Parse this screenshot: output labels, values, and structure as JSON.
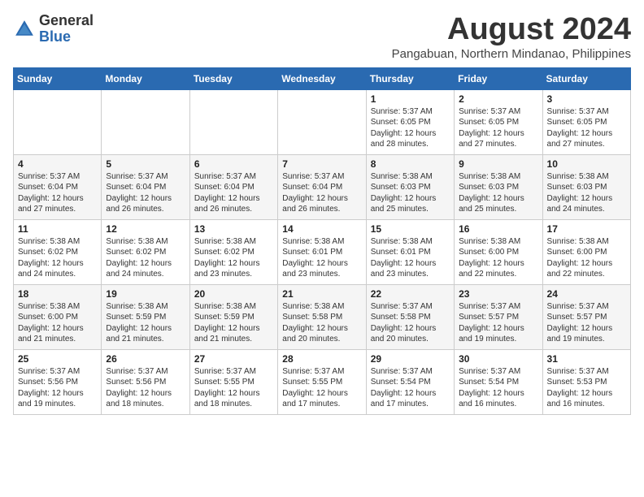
{
  "header": {
    "logo_general": "General",
    "logo_blue": "Blue",
    "month_title": "August 2024",
    "location": "Pangabuan, Northern Mindanao, Philippines"
  },
  "weekdays": [
    "Sunday",
    "Monday",
    "Tuesday",
    "Wednesday",
    "Thursday",
    "Friday",
    "Saturday"
  ],
  "weeks": [
    [
      {
        "day": "",
        "info": ""
      },
      {
        "day": "",
        "info": ""
      },
      {
        "day": "",
        "info": ""
      },
      {
        "day": "",
        "info": ""
      },
      {
        "day": "1",
        "info": "Sunrise: 5:37 AM\nSunset: 6:05 PM\nDaylight: 12 hours\nand 28 minutes."
      },
      {
        "day": "2",
        "info": "Sunrise: 5:37 AM\nSunset: 6:05 PM\nDaylight: 12 hours\nand 27 minutes."
      },
      {
        "day": "3",
        "info": "Sunrise: 5:37 AM\nSunset: 6:05 PM\nDaylight: 12 hours\nand 27 minutes."
      }
    ],
    [
      {
        "day": "4",
        "info": "Sunrise: 5:37 AM\nSunset: 6:04 PM\nDaylight: 12 hours\nand 27 minutes."
      },
      {
        "day": "5",
        "info": "Sunrise: 5:37 AM\nSunset: 6:04 PM\nDaylight: 12 hours\nand 26 minutes."
      },
      {
        "day": "6",
        "info": "Sunrise: 5:37 AM\nSunset: 6:04 PM\nDaylight: 12 hours\nand 26 minutes."
      },
      {
        "day": "7",
        "info": "Sunrise: 5:37 AM\nSunset: 6:04 PM\nDaylight: 12 hours\nand 26 minutes."
      },
      {
        "day": "8",
        "info": "Sunrise: 5:38 AM\nSunset: 6:03 PM\nDaylight: 12 hours\nand 25 minutes."
      },
      {
        "day": "9",
        "info": "Sunrise: 5:38 AM\nSunset: 6:03 PM\nDaylight: 12 hours\nand 25 minutes."
      },
      {
        "day": "10",
        "info": "Sunrise: 5:38 AM\nSunset: 6:03 PM\nDaylight: 12 hours\nand 24 minutes."
      }
    ],
    [
      {
        "day": "11",
        "info": "Sunrise: 5:38 AM\nSunset: 6:02 PM\nDaylight: 12 hours\nand 24 minutes."
      },
      {
        "day": "12",
        "info": "Sunrise: 5:38 AM\nSunset: 6:02 PM\nDaylight: 12 hours\nand 24 minutes."
      },
      {
        "day": "13",
        "info": "Sunrise: 5:38 AM\nSunset: 6:02 PM\nDaylight: 12 hours\nand 23 minutes."
      },
      {
        "day": "14",
        "info": "Sunrise: 5:38 AM\nSunset: 6:01 PM\nDaylight: 12 hours\nand 23 minutes."
      },
      {
        "day": "15",
        "info": "Sunrise: 5:38 AM\nSunset: 6:01 PM\nDaylight: 12 hours\nand 23 minutes."
      },
      {
        "day": "16",
        "info": "Sunrise: 5:38 AM\nSunset: 6:00 PM\nDaylight: 12 hours\nand 22 minutes."
      },
      {
        "day": "17",
        "info": "Sunrise: 5:38 AM\nSunset: 6:00 PM\nDaylight: 12 hours\nand 22 minutes."
      }
    ],
    [
      {
        "day": "18",
        "info": "Sunrise: 5:38 AM\nSunset: 6:00 PM\nDaylight: 12 hours\nand 21 minutes."
      },
      {
        "day": "19",
        "info": "Sunrise: 5:38 AM\nSunset: 5:59 PM\nDaylight: 12 hours\nand 21 minutes."
      },
      {
        "day": "20",
        "info": "Sunrise: 5:38 AM\nSunset: 5:59 PM\nDaylight: 12 hours\nand 21 minutes."
      },
      {
        "day": "21",
        "info": "Sunrise: 5:38 AM\nSunset: 5:58 PM\nDaylight: 12 hours\nand 20 minutes."
      },
      {
        "day": "22",
        "info": "Sunrise: 5:37 AM\nSunset: 5:58 PM\nDaylight: 12 hours\nand 20 minutes."
      },
      {
        "day": "23",
        "info": "Sunrise: 5:37 AM\nSunset: 5:57 PM\nDaylight: 12 hours\nand 19 minutes."
      },
      {
        "day": "24",
        "info": "Sunrise: 5:37 AM\nSunset: 5:57 PM\nDaylight: 12 hours\nand 19 minutes."
      }
    ],
    [
      {
        "day": "25",
        "info": "Sunrise: 5:37 AM\nSunset: 5:56 PM\nDaylight: 12 hours\nand 19 minutes."
      },
      {
        "day": "26",
        "info": "Sunrise: 5:37 AM\nSunset: 5:56 PM\nDaylight: 12 hours\nand 18 minutes."
      },
      {
        "day": "27",
        "info": "Sunrise: 5:37 AM\nSunset: 5:55 PM\nDaylight: 12 hours\nand 18 minutes."
      },
      {
        "day": "28",
        "info": "Sunrise: 5:37 AM\nSunset: 5:55 PM\nDaylight: 12 hours\nand 17 minutes."
      },
      {
        "day": "29",
        "info": "Sunrise: 5:37 AM\nSunset: 5:54 PM\nDaylight: 12 hours\nand 17 minutes."
      },
      {
        "day": "30",
        "info": "Sunrise: 5:37 AM\nSunset: 5:54 PM\nDaylight: 12 hours\nand 16 minutes."
      },
      {
        "day": "31",
        "info": "Sunrise: 5:37 AM\nSunset: 5:53 PM\nDaylight: 12 hours\nand 16 minutes."
      }
    ]
  ]
}
